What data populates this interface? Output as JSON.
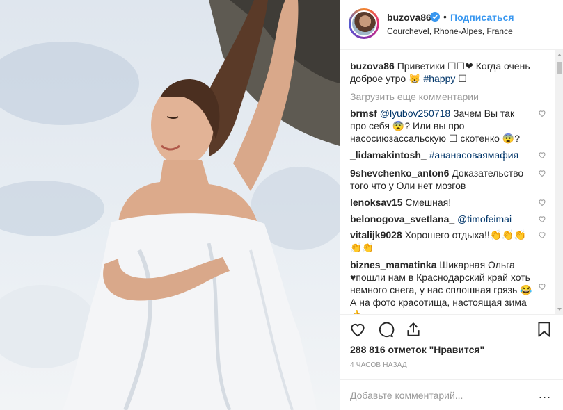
{
  "user": {
    "username": "buzova86",
    "follow_label": "Подписаться",
    "dot": "•",
    "location": "Courchevel, Rhone-Alpes, France"
  },
  "caption": {
    "username": "buzova86",
    "text": "Приветики ☐☐❤ Когда очень доброе утро 😸 ",
    "hashtag": "#happy",
    "text_end": " ☐"
  },
  "load_more_label": "Загрузить еще комментарии",
  "comments": [
    {
      "username": "brmsf",
      "mention": "@lyubov250718",
      "text": " Зачем Вы так про себя 😨? Или вы про насосиюзассальскую ☐ скотенко 😨?"
    },
    {
      "username": "_lidamakintosh_",
      "mention": "#ананасоваямафия",
      "text": ""
    },
    {
      "username": "9shevchenko_anton6",
      "mention": "",
      "text": "Доказательство того что у Оли нет мозгов"
    },
    {
      "username": "lenoksav15",
      "mention": "",
      "text": "Смешная!"
    },
    {
      "username": "belonogova_svetlana_",
      "mention": "@timofeimai",
      "text": ""
    },
    {
      "username": "vitalijk9028",
      "mention": "",
      "text": "Хорошего отдыха!!👏👏👏👏👏"
    },
    {
      "username": "biznes_mamatinka",
      "mention": "",
      "text": "Шикарная Ольга ♥пошли нам в Краснодарский край хоть немного снега, у нас сплошная грязь 😂А на фото красотища, настоящая зима 👍"
    }
  ],
  "likes": "288 816 отметок \"Нравится\"",
  "time": "4 ЧАСОВ НАЗАД",
  "add_comment_placeholder": "Добавьте комментарий...",
  "more_label": "...",
  "icons": [
    "verified-badge-icon",
    "heart-icon",
    "comment-icon",
    "share-icon",
    "bookmark-icon"
  ],
  "colors": {
    "accent": "#3897f0",
    "text": "#262626",
    "muted": "#999999",
    "mention": "#003569"
  }
}
